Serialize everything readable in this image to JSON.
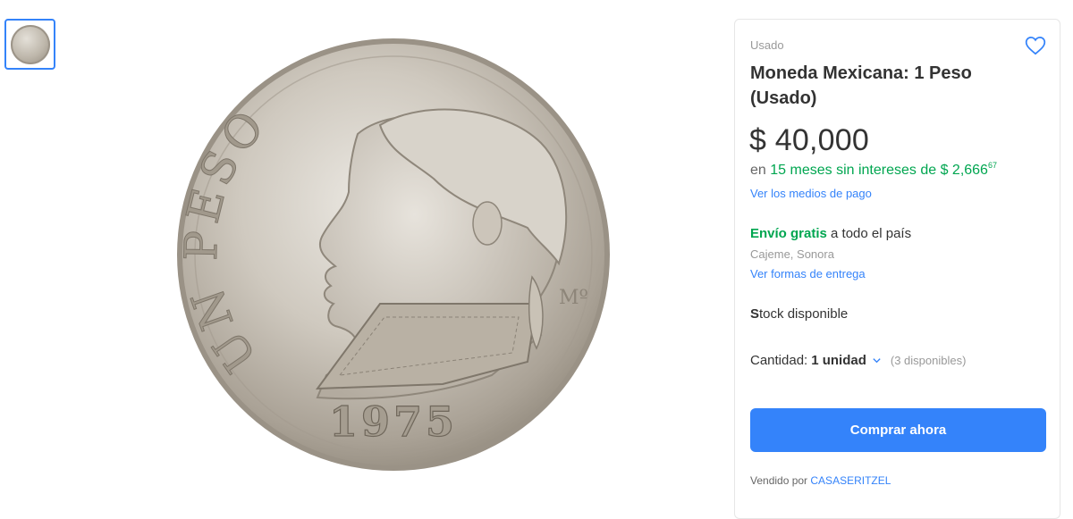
{
  "listing": {
    "condition": "Usado",
    "title": "Moneda Mexicana: 1 Peso (Usado)",
    "price": "$ 40,000",
    "installments": {
      "prefix": "en",
      "months_text": "15 meses sin intereses de $ 2,666",
      "cents": "67"
    },
    "payment_link": "Ver los medios de pago",
    "shipping": {
      "free_label": "Envío gratis",
      "rest": " a todo el país"
    },
    "location": "Cajeme, Sonora",
    "delivery_link": "Ver formas de entrega",
    "stock": {
      "first_letter": "S",
      "rest": "tock disponible"
    },
    "quantity": {
      "label": "Cantidad:",
      "value": "1 unidad",
      "available": "(3 disponibles)"
    },
    "buy_button": "Comprar ahora",
    "seller": {
      "prefix": "Vendido por ",
      "name": "CASASERITZEL"
    }
  },
  "coin": {
    "legend": "UN PESO",
    "year": "1975",
    "mint_mark": "Mº",
    "mint_mark_suffix": "M"
  },
  "icons": {
    "favorite": "heart-outline-icon",
    "quantity": "chevron-down-icon"
  },
  "colors": {
    "accent": "#3483fa",
    "green": "#00a650",
    "text": "#333333",
    "muted": "#999999"
  }
}
